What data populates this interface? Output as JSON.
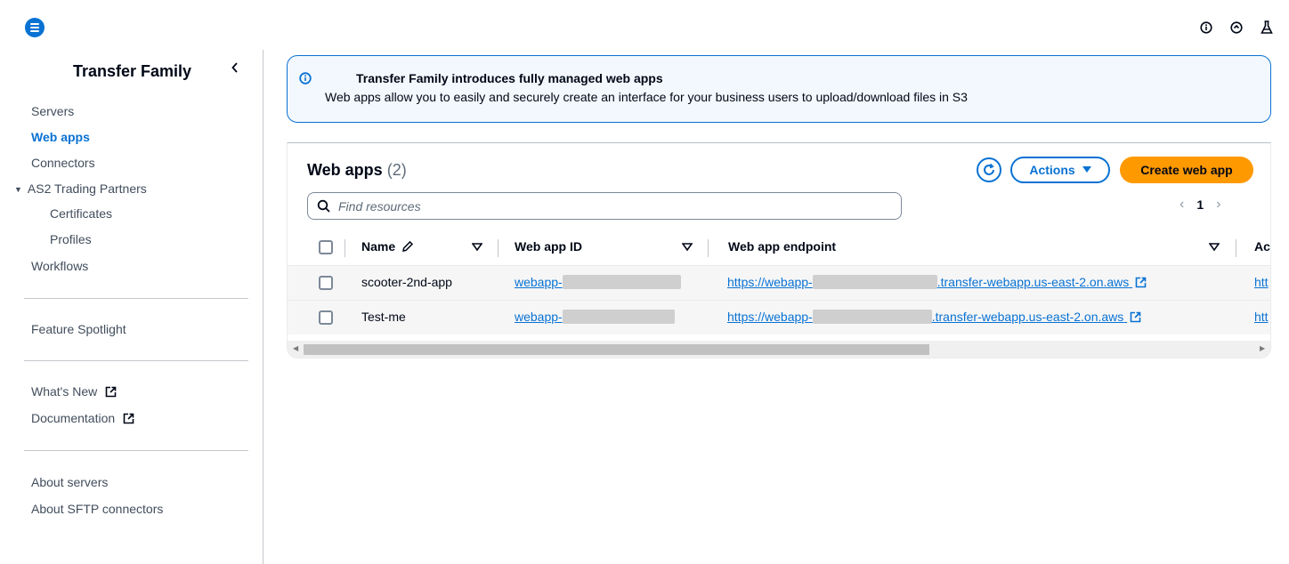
{
  "sidebar": {
    "title": "Transfer Family",
    "nav": [
      "Servers",
      "Web apps",
      "Connectors"
    ],
    "as2_group": "AS2 Trading Partners",
    "as2_children": [
      "Certificates",
      "Profiles"
    ],
    "workflows": "Workflows",
    "feature_spotlight": "Feature Spotlight",
    "whats_new": "What's New",
    "documentation": "Documentation",
    "about_servers": "About servers",
    "about_sftp": "About SFTP connectors"
  },
  "flash": {
    "title": "Transfer Family introduces fully managed web apps",
    "body": "Web apps allow you to easily and securely create an interface for your business users to upload/download files in S3"
  },
  "table": {
    "title": "Web apps",
    "count": "(2)",
    "actions_label": "Actions",
    "create_label": "Create web app",
    "search_placeholder": "Find resources",
    "page": "1",
    "columns": [
      "Name",
      "Web app ID",
      "Web app endpoint",
      "Ac"
    ],
    "rows": [
      {
        "name": "scooter-2nd-app",
        "id_prefix": "webapp-",
        "endpoint_prefix": "https://webapp-",
        "endpoint_suffix": ".transfer-webapp.us-east-2.on.aws",
        "access": "htt"
      },
      {
        "name": "Test-me",
        "id_prefix": "webapp-",
        "endpoint_prefix": "https://webapp-",
        "endpoint_suffix": ".transfer-webapp.us-east-2.on.aws",
        "access": "htt"
      }
    ]
  },
  "colors": {
    "accent": "#0972d3",
    "primary_button": "#ff9900",
    "info_bg": "#f2f8fd"
  },
  "icons": {
    "top_right": [
      "info-icon",
      "notification-icon",
      "labs-icon"
    ]
  }
}
